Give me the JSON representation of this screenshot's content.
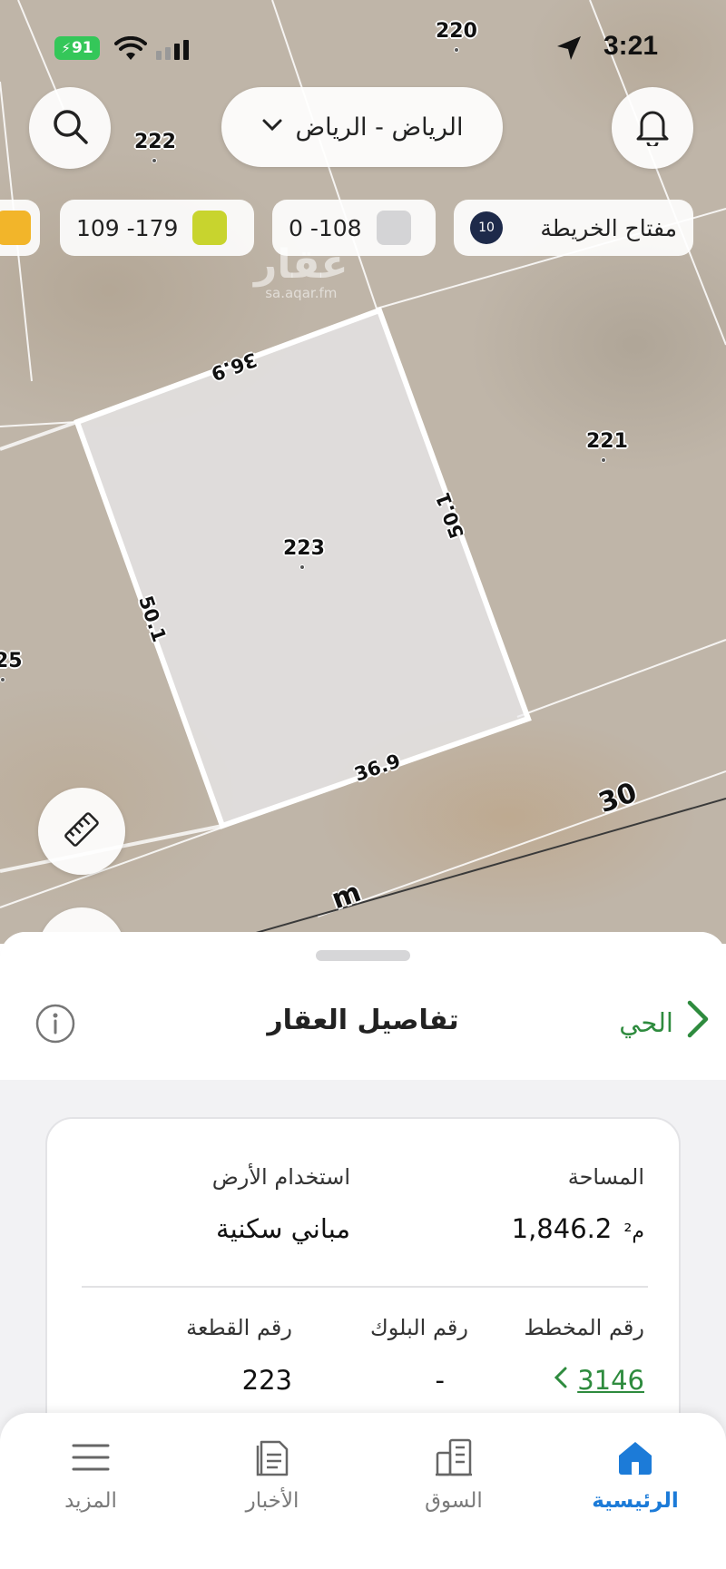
{
  "status_bar": {
    "battery": "91",
    "time": "3:21"
  },
  "header": {
    "city_selector": "الرياض - الرياض"
  },
  "legend": {
    "key_label": "مفتاح الخريطة",
    "key_badge": "10",
    "chips": [
      {
        "label": "0 -108",
        "color": "#d4d4d6"
      },
      {
        "label": "109 -179",
        "color": "#c8d42e"
      },
      {
        "label": "",
        "color": "#f2b52a"
      }
    ]
  },
  "map": {
    "watermark": "عقار",
    "watermark_url": "sa.aqar.fm",
    "plots": [
      "220",
      "222",
      "221",
      "223",
      "25"
    ],
    "dimensions": {
      "top": "36.9",
      "bottom": "36.9",
      "left": "50.1",
      "right": "50.1"
    },
    "streets": [
      "30",
      "m"
    ]
  },
  "sheet": {
    "title": "تفاصيل العقار",
    "district_link": "الحي",
    "area_label": "المساحة",
    "area_value": "1,846.2",
    "area_unit": "م²",
    "land_use_label": "استخدام الأرض",
    "land_use_value": "مباني سكنية",
    "plan_label": "رقم المخطط",
    "plan_value": "3146",
    "block_label": "رقم البلوك",
    "block_value": "-",
    "parcel_label": "رقم القطعة",
    "parcel_value": "223"
  },
  "tabs": [
    {
      "label": "الرئيسية",
      "icon": "home-icon",
      "active": true
    },
    {
      "label": "السوق",
      "icon": "buildings-icon",
      "active": false
    },
    {
      "label": "الأخبار",
      "icon": "news-icon",
      "active": false
    },
    {
      "label": "المزيد",
      "icon": "menu-icon",
      "active": false
    }
  ],
  "colors": {
    "accent_green": "#2e8b3e",
    "active_tab": "#1c7bd8",
    "battery": "#34c759"
  }
}
